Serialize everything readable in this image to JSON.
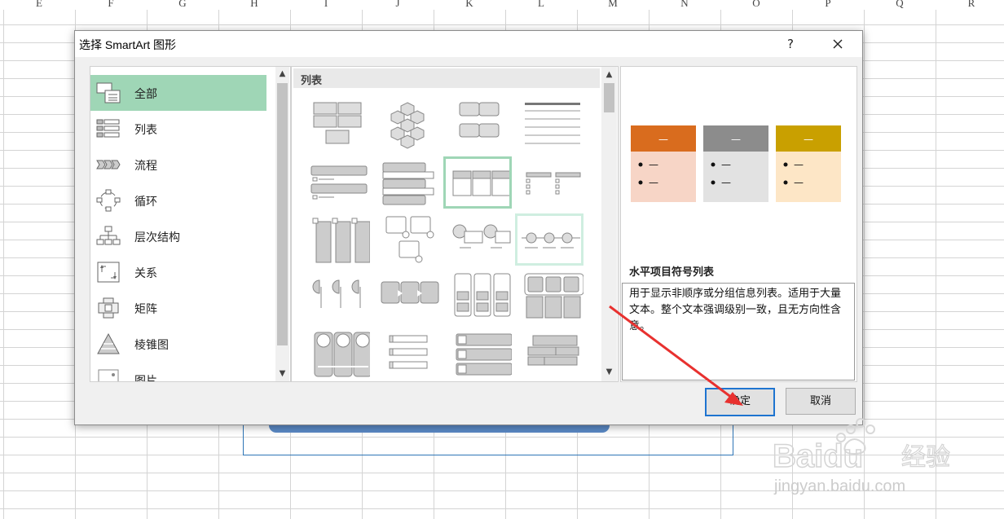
{
  "sheet": {
    "column_headers": [
      "E",
      "F",
      "G",
      "H",
      "I",
      "J",
      "K",
      "L",
      "M",
      "N",
      "O",
      "P",
      "Q",
      "R"
    ]
  },
  "dialog": {
    "title": "选择 SmartArt 图形",
    "help_label": "?",
    "categories": [
      {
        "label": "全部",
        "icon": "all-icon",
        "selected": true
      },
      {
        "label": "列表",
        "icon": "list-icon"
      },
      {
        "label": "流程",
        "icon": "process-icon"
      },
      {
        "label": "循环",
        "icon": "cycle-icon"
      },
      {
        "label": "层次结构",
        "icon": "hierarchy-icon"
      },
      {
        "label": "关系",
        "icon": "relationship-icon"
      },
      {
        "label": "矩阵",
        "icon": "matrix-icon"
      },
      {
        "label": "棱锥图",
        "icon": "pyramid-icon"
      },
      {
        "label": "图片",
        "icon": "picture-icon"
      }
    ],
    "gallery": {
      "section_header": "列表",
      "selected_index": 6,
      "hover_index": 11
    },
    "preview": {
      "title": "水平项目符号列表",
      "description": "用于显示非顺序或分组信息列表。适用于大量文本。整个文本强调级别一致，且无方向性含意。",
      "placeholder": "—",
      "colors": [
        "#d96c1e",
        "#8c8c8c",
        "#c9a000"
      ],
      "body_colors": [
        "#f7d5c6",
        "#e2e2e2",
        "#fde6c6"
      ]
    },
    "ok_label": "确定",
    "cancel_label": "取消"
  },
  "watermark": {
    "brand": "Baidu",
    "cn": "经验",
    "url": "jingyan.baidu.com"
  },
  "colors": {
    "selection": "#9fd6b6",
    "annotation_arrow": "#e8312f",
    "default_button_border": "#1e74d0"
  }
}
